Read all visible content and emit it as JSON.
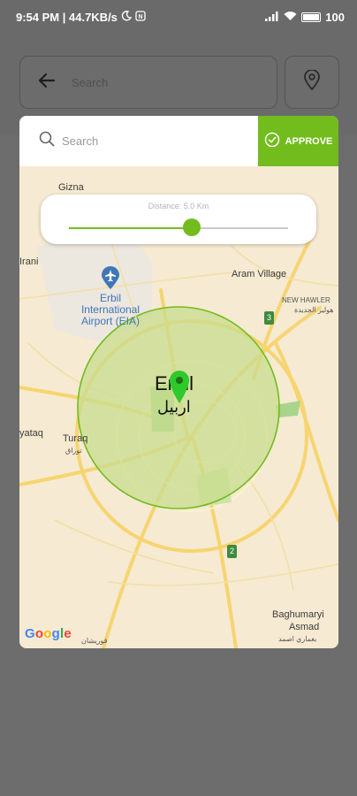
{
  "status_bar": {
    "time_speed": "9:54 PM | 44.7KB/s",
    "moon_icon": "moon-icon",
    "nfc_icon": "nfc-icon",
    "battery": "100"
  },
  "background": {
    "search_placeholder": "Search",
    "back_icon": "arrow-left-icon",
    "location_icon": "location-pin-icon"
  },
  "modal": {
    "search_placeholder": "Search",
    "approve_label": "APPROVE",
    "distance_label": "Distance: 5.0 Km",
    "slider_fraction": 0.56
  },
  "map": {
    "labels": {
      "gizna": "Gizna",
      "irani": "Irani",
      "airport_en": "Erbil International Airport (EIA)",
      "aram_village": "Aram Village",
      "new_hawler": "NEW HAWLER",
      "new_hawler_ar": "هولير الجديدة",
      "erbil_en": "Erbil",
      "erbil_ar": "اربيل",
      "yataq": "yataq",
      "turaq": "Turaq",
      "turaq_ar": "توراق",
      "baghumaryi": "Baghumaryi",
      "asmad": "Asmad",
      "asmad_ar": "بغماري اصمد",
      "qurayshan": "قوريشان",
      "google": "Google"
    },
    "route_badges": [
      "3",
      "2"
    ],
    "colors": {
      "accent_green": "#72bc1d",
      "map_bg": "#f6ead2",
      "road": "#f7d679"
    }
  }
}
